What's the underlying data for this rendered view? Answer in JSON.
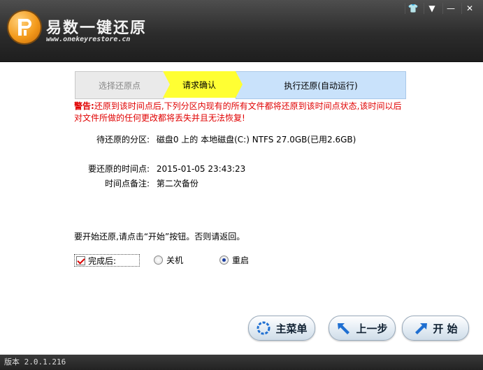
{
  "header": {
    "app_name": "易数一键还原",
    "url": "www.onekeyrestore.cn",
    "controls": [
      "shirt-icon",
      "menu-down-icon",
      "minimize-icon",
      "close-icon"
    ]
  },
  "steps": [
    {
      "label": "选择还原点",
      "state": "done"
    },
    {
      "label": "请求确认",
      "state": "current"
    },
    {
      "label": "执行还原(自动运行)",
      "state": "pending"
    }
  ],
  "warning": {
    "prefix": "警告:",
    "text": "还原到该时间点后,下列分区内现有的所有文件都将还原到该时间点状态,该时间以后对文件所做的任何更改都将丢失并且无法恢复!"
  },
  "details": {
    "partition_label": "待还原的分区:",
    "partition_value": "磁盘0 上的 本地磁盘(C:) NTFS 27.0GB(已用2.6GB)",
    "time_label": "要还原的时间点:",
    "time_value": "2015-01-05 23:43:23",
    "note_label": "时间点备注:",
    "note_value": "第二次备份"
  },
  "prompt": "要开始还原,请点击“开始”按钮。否则请返回。",
  "after_done": {
    "checkbox_label": "完成后:",
    "checked": true,
    "option_shutdown": "关机",
    "option_restart": "重启",
    "selected": "重启"
  },
  "buttons": {
    "main_menu": "主菜单",
    "back": "上一步",
    "start": "开 始"
  },
  "status": {
    "version": "版本 2.0.1.216"
  },
  "colors": {
    "current_step": "#ffff33",
    "pending_step": "#c9e2fb",
    "warning_text": "#e00000"
  }
}
